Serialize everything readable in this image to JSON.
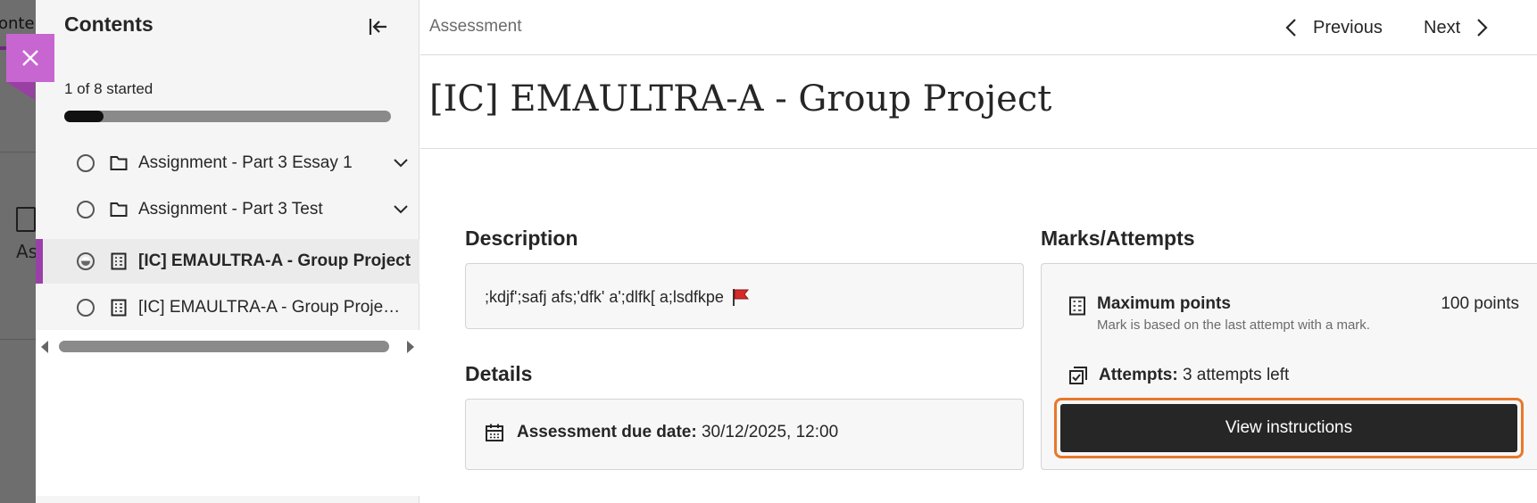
{
  "background": {
    "title_fragment": "onte",
    "icon_label_fragment": "As"
  },
  "sidebar": {
    "title": "Contents",
    "progress_text": "1 of 8 started",
    "progress_fraction": 0.12,
    "items": [
      {
        "label": "Assignment - Part 3 Essay 1",
        "type": "folder",
        "status": "not-started",
        "expandable": true
      },
      {
        "label": "Assignment - Part 3 Test",
        "type": "folder",
        "status": "not-started",
        "expandable": true
      },
      {
        "label": "[IC] EMAULTRA-A - Group Project",
        "type": "assessment",
        "status": "in-progress",
        "active": true
      },
      {
        "label": "[IC] EMAULTRA-A - Group Project...",
        "type": "assessment",
        "status": "not-started"
      }
    ]
  },
  "topbar": {
    "breadcrumb": "Assessment",
    "previous_label": "Previous",
    "next_label": "Next"
  },
  "page": {
    "title": "[IC] EMAULTRA-A - Group Project",
    "description_heading": "Description",
    "description_text": ";kdjf';safj afs;'dfk' a';dlfk[ a;lsdfkpe",
    "details_heading": "Details",
    "due_label": "Assessment due date:",
    "due_value": "30/12/2025, 12:00",
    "marks_heading": "Marks/Attempts",
    "max_points_label": "Maximum points",
    "max_points_note": "Mark is based on the last attempt with a mark.",
    "max_points_value": "100 points",
    "attempts_label": "Attempts:",
    "attempts_value": "3 attempts left",
    "view_button": "View instructions"
  },
  "colors": {
    "accent_purple": "#9b3fa8",
    "close_tab": "#c766d0",
    "focus_orange": "#e8782a",
    "button_dark": "#262626"
  }
}
